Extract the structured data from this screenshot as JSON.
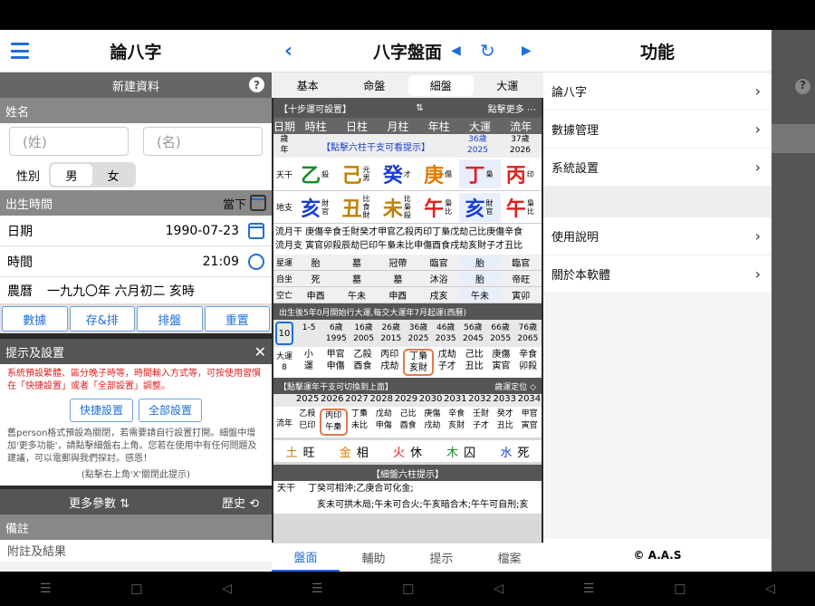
{
  "p1": {
    "title": "論八字",
    "new_record": "新建資料",
    "name_label": "姓名",
    "surname_ph": "(姓)",
    "given_ph": "(名)",
    "gender_label": "性別",
    "male": "男",
    "female": "女",
    "birth_label": "出生時間",
    "now_label": "當下",
    "date_label": "日期",
    "date_value": "1990-07-23",
    "time_label": "時間",
    "time_value": "21:09",
    "lunar_label": "農曆",
    "lunar_value": "一九九〇年 六月初二 亥時",
    "buttons": [
      "數據",
      "存&排",
      "排盤",
      "重置"
    ],
    "tips_title": "提示及設置",
    "tips_text": "系統預設繁體、區分晚子時等，時間輸入方式等，可按使用習慣在「快捷設置」或者「全部設置」調整。",
    "quick_settings": "快捷設置",
    "all_settings": "全部設置",
    "info_text": "舊person格式預設為關閉，若需要請自行設置打開。細盤中增加'更多功能'，請點擊細盤右上角。您若在使用中有任何問題及建議，可以電郵與我們探討。感恩！",
    "close_hint": "(點擊右上角'X'關閉此提示)",
    "more_params": "更多參數",
    "history": "歷史",
    "notes_label": "備註",
    "notes_ph": "附註及結果"
  },
  "p2": {
    "title": "八字盤面",
    "tabs": [
      "基本",
      "命盤",
      "細盤",
      "大運"
    ],
    "step_label": "【十步運可設置】",
    "click_more": "點擊更多",
    "headers": [
      "日期",
      "時柱",
      "日柱",
      "月柱",
      "年柱",
      "大運",
      "流年"
    ],
    "age_label": "歲\n年",
    "hint_click": "【點擊六柱干支可看提示】",
    "dayun_age": "36歲",
    "dayun_year": "2025",
    "liunian_age": "37歲",
    "liunian_year": "2026",
    "tiangan_label": "天干",
    "dizhi_label": "地支",
    "stems": [
      {
        "c": "乙",
        "s": "殺",
        "col": "#1a8a2a"
      },
      {
        "c": "己",
        "s": "元男",
        "col": "#c08000"
      },
      {
        "c": "癸",
        "s": "才",
        "col": "#1a3fcf"
      },
      {
        "c": "庚",
        "s": "傷",
        "col": "#e07a00"
      },
      {
        "c": "丁",
        "s": "梟",
        "col": "#e02020"
      },
      {
        "c": "丙",
        "s": "印",
        "col": "#e02020"
      }
    ],
    "branches": [
      {
        "c": "亥",
        "s": "財官",
        "col": "#1a3fcf"
      },
      {
        "c": "丑",
        "s": "比食財",
        "col": "#c08000"
      },
      {
        "c": "未",
        "s": "比梟殺",
        "col": "#c08000"
      },
      {
        "c": "午",
        "s": "梟比",
        "col": "#e02020"
      },
      {
        "c": "亥",
        "s": "財官",
        "col": "#1a3fcf"
      },
      {
        "c": "午",
        "s": "梟比",
        "col": "#e02020"
      }
    ],
    "flow_row1": "流月干 庚傷辛食壬財癸才甲官乙殺丙印丁梟戊劫己比庚傷辛食",
    "flow_row2": "流月支 寅官卯殺辰劫巳印午梟未比申傷酉食戌劫亥財子才丑比",
    "star_label": "星運",
    "self_label": "自坐",
    "void_label": "空亡",
    "star_vals": [
      "胎",
      "墓",
      "冠帶",
      "臨官",
      "胎",
      "臨官"
    ],
    "self_vals": [
      "死",
      "墓",
      "墓",
      "沐浴",
      "胎",
      "帝旺"
    ],
    "void_vals": [
      "申酉",
      "午未",
      "申酉",
      "戌亥",
      "午未",
      "寅卯"
    ],
    "dayun_header": "出生後5年0月開始行大運,每交大運年7月起運(西曆)",
    "dayun_sel": "10",
    "dayun_ages": [
      "1-5",
      "6歲\n1995",
      "16歲\n2005",
      "26歲\n2015",
      "36歲\n2025",
      "46歲\n2035",
      "56歲\n2045",
      "66歲\n2055",
      "76歲\n2065"
    ],
    "dayun_label": "大運\n8",
    "dayun_gz": [
      "小\n運",
      "甲官\n申傷",
      "乙殺\n酉食",
      "丙印\n戌劫",
      "丁梟\n亥財",
      "戊劫\n子才",
      "己比\n丑比",
      "庚傷\n寅官",
      "辛食\n卯殺"
    ],
    "liunian_header": "【點擊運年干支可切換到上面】",
    "liunian_loc": "歲運定位",
    "ln_years": [
      "2025",
      "2026",
      "2027",
      "2028",
      "2029",
      "2030",
      "2031",
      "2032",
      "2033",
      "2034"
    ],
    "ln_label": "流年",
    "ln_gz": [
      "乙殺\n巳印",
      "丙印\n午梟",
      "丁梟\n未比",
      "戊劫\n申傷",
      "己比\n酉食",
      "庚傷\n戌劫",
      "辛食\n亥財",
      "壬財\n子才",
      "癸才\n丑比",
      "甲官\n寅官"
    ],
    "wuxing": [
      {
        "e": "土",
        "s": "旺",
        "col": "#c08000"
      },
      {
        "e": "金",
        "s": "相",
        "col": "#e07a00"
      },
      {
        "e": "火",
        "s": "休",
        "col": "#e02020"
      },
      {
        "e": "木",
        "s": "囚",
        "col": "#1a8a2a"
      },
      {
        "e": "水",
        "s": "死",
        "col": "#1a3fcf"
      }
    ],
    "detail_header": "【細盤六柱提示】",
    "detail_tg_label": "天干",
    "detail_tg": "丁癸可相沖;乙庚合可化金;",
    "detail_dz": "亥未可拱木局;午未可合火;午亥暗合木;午午可自刑;亥",
    "bottom_tabs": [
      "盤面",
      "輔助",
      "提示",
      "檔案"
    ]
  },
  "p3": {
    "title": "功能",
    "menu1": [
      "論八字",
      "數據管理",
      "系統設置"
    ],
    "menu2": [
      "使用說明",
      "關於本軟體"
    ],
    "footer": "© A.A.S"
  },
  "colors": {
    "accent": "#1e6fd9",
    "header_gray": "#666666",
    "tip_red": "#e02020"
  }
}
